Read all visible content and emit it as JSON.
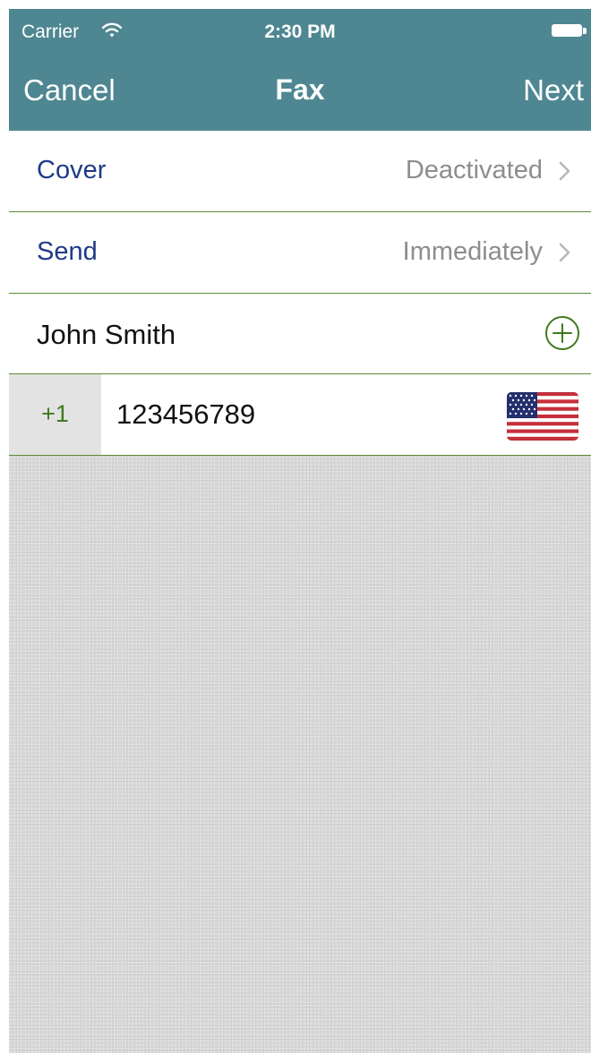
{
  "status_bar": {
    "carrier": "Carrier",
    "time": "2:30 PM"
  },
  "nav": {
    "cancel_label": "Cancel",
    "title": "Fax",
    "next_label": "Next"
  },
  "cover": {
    "label": "Cover",
    "value": "Deactivated"
  },
  "send": {
    "label": "Send",
    "value": "Immediately"
  },
  "recipient": {
    "name": "John Smith"
  },
  "phone": {
    "country_code": "+1",
    "number": "123456789",
    "flag_icon": "us-flag-icon"
  },
  "colors": {
    "header": "#4e8791",
    "label_blue": "#1f3a87",
    "divider_green": "#5b8c32",
    "code_green": "#3f7a1f"
  }
}
